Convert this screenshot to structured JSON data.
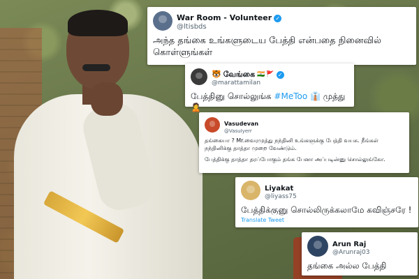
{
  "tweets": [
    {
      "name": "War Room - Volunteer",
      "handle": "@ltisbds",
      "verified": true,
      "text": "அந்த தங்கை உங்களுடைய பேத்தி என்பதை நினைவில் கொள்ளுங்கள்"
    },
    {
      "name": "வேங்கை",
      "name_prefix_icon": "tiger-emoji",
      "name_suffix_icons": [
        "india-flag-emoji",
        "red-flag-emoji"
      ],
      "handle": "@marattamilan",
      "verified": true,
      "text_before": "பேத்தினு சொல்லுங்க ",
      "hashtag": "#MeToo",
      "text_after": " 👔 முத்து 🙎"
    },
    {
      "name": "Vasudevan",
      "handle": "@VasuIyerr",
      "verified": false,
      "text_p1": "தங்கையா ? Mr.வைரமுத்து நந்தினி உங்களுக்கு பேத்தி வயசு. நீங்கள் நந்தினிக்கு தாத்தா முறை வேண்டும்.",
      "text_p2": "பேத்திக்கு தாத்தா தரப்போகும் தங்க பேனா அப்படின்னு சொல்லுங்கோ."
    },
    {
      "name": "Liyakat",
      "handle": "@liyass75",
      "verified": false,
      "text": "பேத்திக்குனு சொல்லிருக்கலாமே கவிஞ்சரே !",
      "translate": "Translate Tweet"
    },
    {
      "name": "Arun Raj",
      "handle": "@Arunraj03",
      "verified": false,
      "text": "தங்கை அல்ல பேத்தி"
    }
  ],
  "colors": {
    "verified": "#1d9bf0",
    "link": "#1d9bf0",
    "text": "#0f1419",
    "muted": "#536471"
  }
}
